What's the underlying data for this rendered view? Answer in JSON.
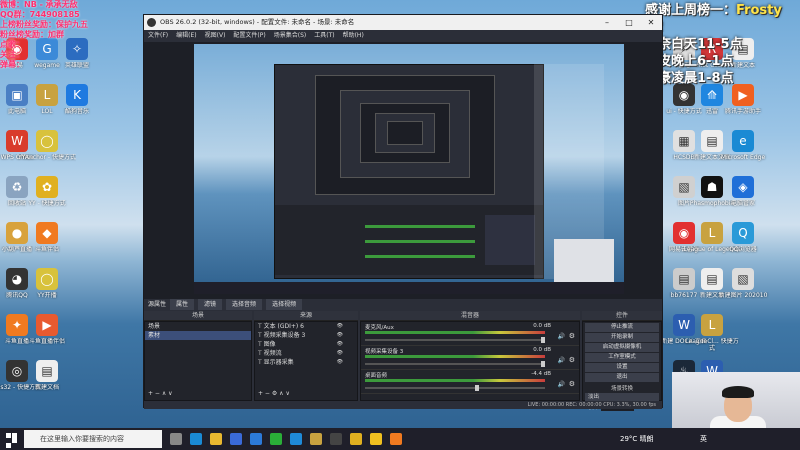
{
  "overlay_left": [
    "微博：NB - 承承无敌",
    "QQ群：744908185",
    "上榜粉丝奖励：保护九五",
    "粉丝榜奖励：加群",
    "点歌：",
    "关注：",
    "弹幕："
  ],
  "overlay_right": {
    "line1_a": "感谢上周榜一：",
    "line1_b": "Frosty优!",
    "line2": "碧奈白天11-5点",
    "line3": "小皮晚上6-1点",
    "line4": "阿豪凌晨1-8点"
  },
  "left_icons": [
    {
      "label": "网易",
      "color": "#e23030",
      "glyph": "◉"
    },
    {
      "label": "此电脑",
      "color": "#4a7fc4",
      "glyph": "▣"
    },
    {
      "label": "WPS Office",
      "color": "#d93c2c",
      "glyph": "W"
    },
    {
      "label": "回收站",
      "color": "#8aa4c0",
      "glyph": "♻"
    },
    {
      "label": "小葫芦直播",
      "color": "#d8a23c",
      "glyph": "●"
    },
    {
      "label": "腾讯QQ",
      "color": "#333",
      "glyph": "◕"
    },
    {
      "label": "斗鱼直播",
      "color": "#f07a20",
      "glyph": "✦"
    },
    {
      "label": "obs32 - 快捷方式",
      "color": "#333",
      "glyph": "◎"
    },
    {
      "label": "wegame",
      "color": "#3c8ad8",
      "glyph": "G"
    },
    {
      "label": "LOL",
      "color": "#c8a240",
      "glyph": "L"
    },
    {
      "label": "YYAnchor - 快捷方式",
      "color": "#d8c23c",
      "glyph": "◯"
    },
    {
      "label": "YY - 快捷方式",
      "color": "#e0b020",
      "glyph": "✿"
    },
    {
      "label": "斗鱼伴侣",
      "color": "#f07a20",
      "glyph": "◆"
    },
    {
      "label": "YY开播",
      "color": "#d8c23c",
      "glyph": "◯"
    },
    {
      "label": "斗鱼直播伴侣",
      "color": "#e85a30",
      "glyph": "▶"
    },
    {
      "label": "新建文档",
      "color": "#eeeeee",
      "glyph": "▤"
    },
    {
      "label": "英雄联盟",
      "color": "#2c6cc0",
      "glyph": "✧"
    },
    {
      "label": "酷狗音乐",
      "color": "#1f7ae0",
      "glyph": "K"
    }
  ],
  "right_icons": [
    {
      "label": "雷电",
      "color": "#e0e0e0",
      "glyph": "⚡"
    },
    {
      "label": "ui - 快捷方式",
      "color": "#333",
      "glyph": "◉"
    },
    {
      "label": "HCSDB",
      "color": "#e0e0e0",
      "glyph": "▦"
    },
    {
      "label": "图片",
      "color": "#d0d0d0",
      "glyph": "▧"
    },
    {
      "label": "网易云音乐",
      "color": "#e23030",
      "glyph": "◉"
    },
    {
      "label": "bb76177",
      "color": "#ccc",
      "glyph": "▤"
    },
    {
      "label": "新建 DOCX 文档",
      "color": "#2c5eb0",
      "glyph": "W"
    },
    {
      "label": "Steam",
      "color": "#1b2838",
      "glyph": "♨"
    },
    {
      "label": "Riot Client",
      "color": "#d13639",
      "glyph": "R"
    },
    {
      "label": "迅雷",
      "color": "#1f86e0",
      "glyph": "⟰"
    },
    {
      "label": "新建文本文档",
      "color": "#eeeeee",
      "glyph": "▤"
    },
    {
      "label": "Phasmophobia",
      "color": "#111",
      "glyph": "☗"
    },
    {
      "label": "League of Legends",
      "color": "#c8a240",
      "glyph": "L"
    },
    {
      "label": "新建文本",
      "color": "#eeeeee",
      "glyph": "▤"
    },
    {
      "label": "LeagueCl... 快捷方式",
      "color": "#c8a240",
      "glyph": "L"
    },
    {
      "label": "新建文档",
      "color": "#2c5eb0",
      "glyph": "W"
    },
    {
      "label": "新建文本",
      "color": "#eeeeee",
      "glyph": "▤"
    },
    {
      "label": "腾讯手游助手",
      "color": "#f06020",
      "glyph": "▶"
    },
    {
      "label": "Microsoft Edge",
      "color": "#1a8ad4",
      "glyph": "e"
    },
    {
      "label": "电脑管家",
      "color": "#1f6fd8",
      "glyph": "◈"
    },
    {
      "label": "QQ浏览器",
      "color": "#2a9ad8",
      "glyph": "Q"
    },
    {
      "label": "新建图片 202010",
      "color": "#ddd",
      "glyph": "▧"
    }
  ],
  "obs": {
    "title": "OBS 26.0.2 (32-bit, windows) - 配置文件: 未命名 - 场景: 未命名",
    "menu": [
      "文件(F)",
      "编辑(E)",
      "视图(V)",
      "配置文件(P)",
      "场景集合(S)",
      "工具(T)",
      "帮助(H)"
    ],
    "bar_label": "源属性",
    "bar_buttons": [
      "属性",
      "滤镜",
      "选择音频",
      "选择视频"
    ],
    "scenes_title": "场景",
    "scenes": [
      "场景",
      "素材"
    ],
    "sources_title": "来源",
    "sources": [
      "文本 (GDI+) 6",
      "视频采集设备 3",
      "图像",
      "视频流",
      "显示器采集"
    ],
    "mixer_title": "混音器",
    "mixer": [
      {
        "name": "麦克风/Aux",
        "db": "0.0 dB"
      },
      {
        "name": "视频采集设备 3",
        "db": "0.0 dB"
      },
      {
        "name": "桌面音频",
        "db": "-4.4 dB"
      }
    ],
    "controls_title": "控件",
    "controls": [
      "停止推流",
      "开始录制",
      "启动虚拟摄像机",
      "工作室模式",
      "设置",
      "退出"
    ],
    "transition_title": "场景转换",
    "transition_value": "淡出",
    "duration_label": "时长",
    "duration_value": "300 ms",
    "status": "LIVE: 00:00:00   REC: 00:00:00   CPU: 3.3%, 30.00 fps"
  },
  "taskbar": {
    "search_placeholder": "在这里输入你要搜索的内容",
    "weather": "29°C 晴朗",
    "lang": "英",
    "time": "",
    "apps": [
      "task-view",
      "edge",
      "explorer",
      "store",
      "mail",
      "wechat",
      "qq",
      "lol",
      "obs",
      "chrome",
      "yy",
      "douyu"
    ]
  }
}
